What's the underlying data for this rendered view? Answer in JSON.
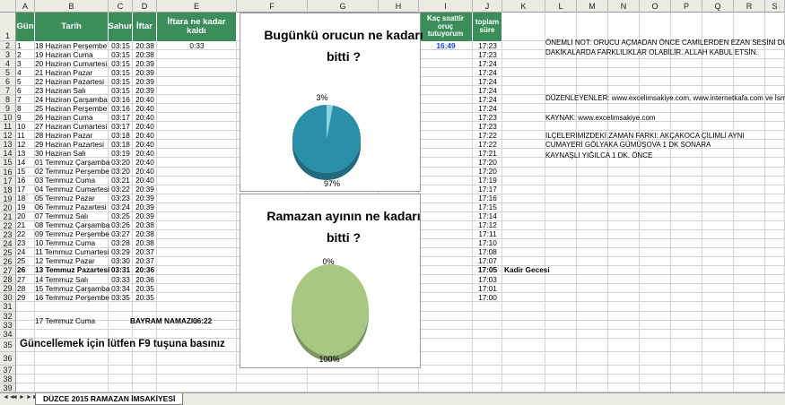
{
  "columns": [
    "A",
    "B",
    "C",
    "D",
    "E",
    "F",
    "G",
    "H",
    "I",
    "J",
    "K",
    "L",
    "M",
    "N",
    "O",
    "P",
    "Q",
    "R",
    "S"
  ],
  "row_numbers": [
    "1",
    "2",
    "3",
    "4",
    "5",
    "6",
    "7",
    "8",
    "9",
    "10",
    "11",
    "12",
    "13",
    "14",
    "15",
    "16",
    "17",
    "18",
    "19",
    "20",
    "21",
    "22",
    "23",
    "24",
    "25",
    "26",
    "27",
    "28",
    "29",
    "30",
    "31",
    "32",
    "33",
    "34",
    "35",
    "36",
    "37",
    "38",
    "39"
  ],
  "headers": {
    "gun": "Gün",
    "tarih": "Tarih",
    "sahur": "Sahur",
    "iftar": "İftar",
    "kalan": "İftara ne kadar kaldı",
    "oruc": "Kaç saattir oruç tutuyorum",
    "toplam": "toplam süre"
  },
  "current": {
    "kalan": "0:33",
    "oruc": "16:49"
  },
  "rows": [
    {
      "n": "1",
      "date": "18 Haziran Perşembe",
      "sahur": "03:15",
      "iftar": "20:38",
      "total": "17:23"
    },
    {
      "n": "2",
      "date": "19 Haziran Cuma",
      "sahur": "03:15",
      "iftar": "20:38",
      "total": "17:23"
    },
    {
      "n": "3",
      "date": "20 Haziran Cumartesi",
      "sahur": "03:15",
      "iftar": "20:39",
      "total": "17:24"
    },
    {
      "n": "4",
      "date": "21 Haziran Pazar",
      "sahur": "03:15",
      "iftar": "20:39",
      "total": "17:24"
    },
    {
      "n": "5",
      "date": "22 Haziran Pazartesi",
      "sahur": "03:15",
      "iftar": "20:39",
      "total": "17:24"
    },
    {
      "n": "6",
      "date": "23 Haziran Salı",
      "sahur": "03:15",
      "iftar": "20:39",
      "total": "17:24"
    },
    {
      "n": "7",
      "date": "24 Haziran Çarşamba",
      "sahur": "03:16",
      "iftar": "20:40",
      "total": "17:24"
    },
    {
      "n": "8",
      "date": "25 Haziran Perşembe",
      "sahur": "03:16",
      "iftar": "20:40",
      "total": "17:24"
    },
    {
      "n": "9",
      "date": "26 Haziran Cuma",
      "sahur": "03:17",
      "iftar": "20:40",
      "total": "17:23"
    },
    {
      "n": "10",
      "date": "27 Haziran Cumartesi",
      "sahur": "03:17",
      "iftar": "20:40",
      "total": "17:23"
    },
    {
      "n": "11",
      "date": "28 Haziran Pazar",
      "sahur": "03:18",
      "iftar": "20:40",
      "total": "17:22"
    },
    {
      "n": "12",
      "date": "29 Haziran Pazartesi",
      "sahur": "03:18",
      "iftar": "20:40",
      "total": "17:22"
    },
    {
      "n": "13",
      "date": "30 Haziran Salı",
      "sahur": "03:19",
      "iftar": "20:40",
      "total": "17:21"
    },
    {
      "n": "14",
      "date": "01 Temmuz Çarşamba",
      "sahur": "03:20",
      "iftar": "20:40",
      "total": "17:20"
    },
    {
      "n": "15",
      "date": "02 Temmuz Perşembe",
      "sahur": "03:20",
      "iftar": "20:40",
      "total": "17:20"
    },
    {
      "n": "16",
      "date": "03 Temmuz Cuma",
      "sahur": "03:21",
      "iftar": "20:40",
      "total": "17:19"
    },
    {
      "n": "17",
      "date": "04 Temmuz Cumartesi",
      "sahur": "03:22",
      "iftar": "20:39",
      "total": "17:17"
    },
    {
      "n": "18",
      "date": "05 Temmuz Pazar",
      "sahur": "03:23",
      "iftar": "20:39",
      "total": "17:16"
    },
    {
      "n": "19",
      "date": "06 Temmuz Pazartesi",
      "sahur": "03:24",
      "iftar": "20:39",
      "total": "17:15"
    },
    {
      "n": "20",
      "date": "07 Temmuz Salı",
      "sahur": "03:25",
      "iftar": "20:39",
      "total": "17:14"
    },
    {
      "n": "21",
      "date": "08 Temmuz Çarşamba",
      "sahur": "03:26",
      "iftar": "20:38",
      "total": "17:12"
    },
    {
      "n": "22",
      "date": "09 Temmuz Perşembe",
      "sahur": "03:27",
      "iftar": "20:38",
      "total": "17:11"
    },
    {
      "n": "23",
      "date": "10 Temmuz Cuma",
      "sahur": "03:28",
      "iftar": "20:38",
      "total": "17:10"
    },
    {
      "n": "24",
      "date": "11 Temmuz Cumartesi",
      "sahur": "03:29",
      "iftar": "20:37",
      "total": "17:08"
    },
    {
      "n": "25",
      "date": "12 Temmuz Pazar",
      "sahur": "03:30",
      "iftar": "20:37",
      "total": "17:07"
    },
    {
      "n": "26",
      "date": "13 Temmuz Pazartesi",
      "sahur": "03:31",
      "iftar": "20:36",
      "total": "17:05",
      "bold": true,
      "note": "Kadir Gecesi"
    },
    {
      "n": "27",
      "date": "14 Temmuz Salı",
      "sahur": "03:33",
      "iftar": "20:36",
      "total": "17:03"
    },
    {
      "n": "28",
      "date": "15 Temmuz Çarşamba",
      "sahur": "03:34",
      "iftar": "20:35",
      "total": "17:01"
    },
    {
      "n": "29",
      "date": "16 Temmuz Perşembe",
      "sahur": "03:35",
      "iftar": "20:35",
      "total": "17:00"
    }
  ],
  "bayram": {
    "date": "17 Temmuz Cuma",
    "label": "BAYRAM NAMAZI :",
    "time": "06:22"
  },
  "update_note": "Güncellemek için lütfen F9 tuşuna basınız",
  "notes": [
    "ÖNEMLİ NOT: ORUCU AÇMADAN ÖNCE CAMİLERDEN EZAN SESİNİ DUYUNUZ.",
    "DAKİKALARDA FARKLILIKLAR OLABİLİR. ALLAH KABUL ETSİN.",
    "DÜZENLEYENLER: www.excelimsakiye.com, www.internetkafa.com ve İsmail Fiden",
    "KAYNAK: www.excelimsakiye.com",
    "İLÇELERİMİZDEKİ ZAMAN FARKI: AKÇAKOCA ÇİLİMLİ AYNI",
    "CUMAYERİ GÖLYAKA GÜMÜŞOVA 1 DK SONARA",
    "KAYNAŞLI YIĞILCA 1 DK. ÖNCE"
  ],
  "chart_data": [
    {
      "type": "pie",
      "title": "Bugünkü orucun ne kadarı bitti ?",
      "labels": [
        "3%",
        "97%"
      ],
      "values": [
        3,
        97
      ],
      "colors": [
        "#8fd3e0",
        "#2a8fa8"
      ]
    },
    {
      "type": "pie",
      "title": "Ramazan ayının ne kadarı bitti ?",
      "labels": [
        "0%",
        "100%"
      ],
      "values": [
        0,
        100
      ],
      "colors": [
        "#d9e8b8",
        "#a7c883"
      ]
    }
  ],
  "sheet_tab": "DÜZCE 2015 RAMAZAN İMSAKİYESİ",
  "nav": [
    "◄◄",
    "◄",
    "►",
    "►►"
  ],
  "colors": {
    "header_green": "#3b8e5a",
    "grid": "#d4d4d4",
    "chrome": "#ecebe3"
  }
}
